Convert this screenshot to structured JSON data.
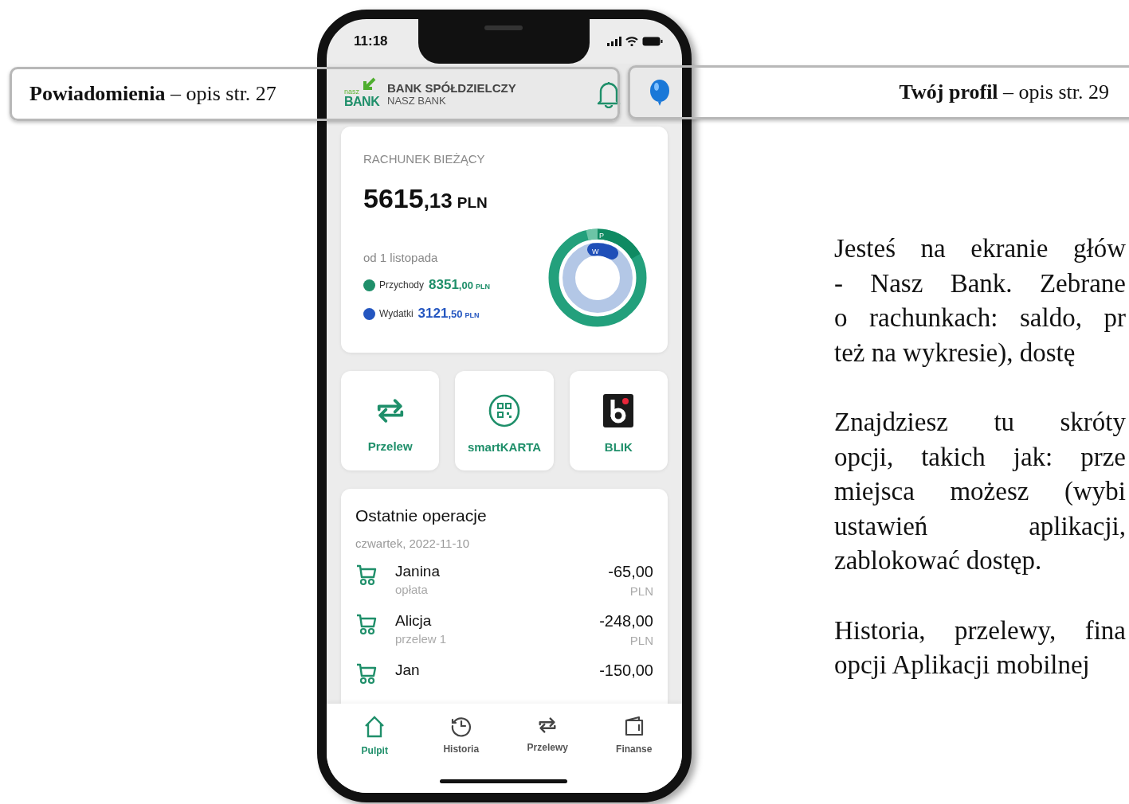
{
  "callouts": [
    {
      "text": "**Powiadomienia** – opis str. 27"
    },
    {
      "text": "**Twój profil** – opis str. 29"
    }
  ],
  "phone": {
    "status_bar": {
      "time": "11:18"
    },
    "header": {
      "logo_small": "nasz",
      "logo_big": "BANK",
      "bank_name": "BANK SPÓŁDZIELCZY",
      "bank_subname": "NASZ BANK"
    },
    "account": {
      "title": "RACHUNEK BIEŻĄCY",
      "balance_main": "5615",
      "balance_decimal": ",13",
      "currency": "PLN",
      "period": "od 1 listopada",
      "legend": [
        {
          "label": "Przychody",
          "main": "8351",
          "decimal": ",00",
          "currency": "PLN",
          "color": "#1f8f6a"
        },
        {
          "label": "Wydatki",
          "main": "3121",
          "decimal": ",50",
          "currency": "PLN",
          "color": "#2456c0"
        }
      ],
      "chart_labels": [
        "P",
        "W"
      ]
    },
    "shortcuts": [
      {
        "label": "Przelew"
      },
      {
        "label": "smartKARTA"
      },
      {
        "label": "BLIK"
      }
    ],
    "operations": {
      "title": "Ostatnie operacje",
      "date": "czwartek, 2022-11-10",
      "rows": [
        {
          "name": "Janina",
          "description": "opłata",
          "amount": "-65,00",
          "currency": "PLN"
        },
        {
          "name": "Alicja",
          "description": "przelew 1",
          "amount": "-248,00",
          "currency": "PLN"
        },
        {
          "name": "Jan",
          "amount": "-150,00"
        }
      ]
    },
    "nav": [
      {
        "label": "Pulpit",
        "selected": true
      },
      {
        "label": "Historia",
        "selected": false
      },
      {
        "label": "Przelewy",
        "selected": false
      },
      {
        "label": "Finanse",
        "selected": false
      }
    ]
  },
  "description": {
    "paragraphs": [
      [
        "Jesteś na  ekranie głów",
        "- Nasz Bank. Zebrane",
        "o rachunkach: saldo, pr",
        "też na wykresie), dostę"
      ],
      [
        "Znajdziesz tu skróty",
        "opcji, takich jak: prze",
        "miejsca możesz (wybi",
        "ustawień aplikacji,",
        "zablokować dostęp."
      ],
      [
        "Historia, przelewy, fina",
        "opcji Aplikacji mobilnej"
      ]
    ]
  }
}
